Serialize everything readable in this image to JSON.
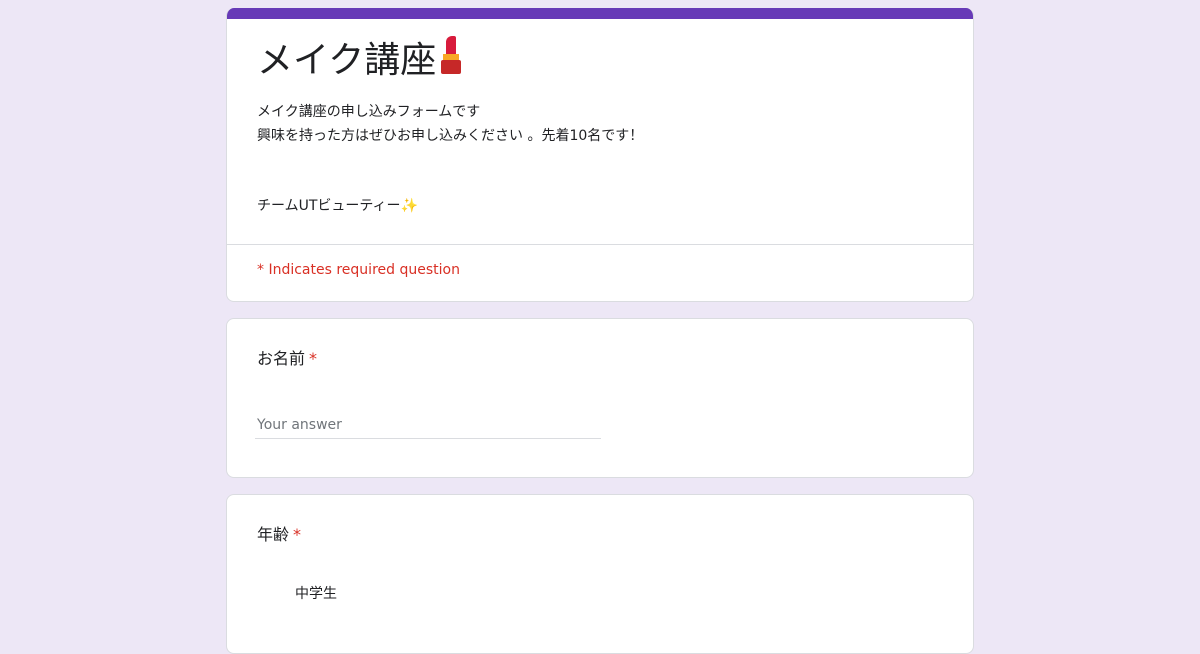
{
  "header": {
    "title": "メイク講座",
    "title_icon": "lipstick-icon",
    "description_lines": [
      "メイク講座の申し込みフォームです",
      "興味を持った方はぜひお申し込みください 。先着10名です！"
    ],
    "team_line": "チームUTビューティー✨",
    "required_note": "* Indicates required question"
  },
  "questions": [
    {
      "title": "お名前",
      "required_mark": "*",
      "input_placeholder": "Your answer"
    },
    {
      "title": "年齢",
      "required_mark": "*",
      "options": [
        "中学生"
      ]
    }
  ],
  "colors": {
    "accent": "#673ab7",
    "background": "#ede7f6",
    "required": "#d93025",
    "border": "#dadce0"
  }
}
